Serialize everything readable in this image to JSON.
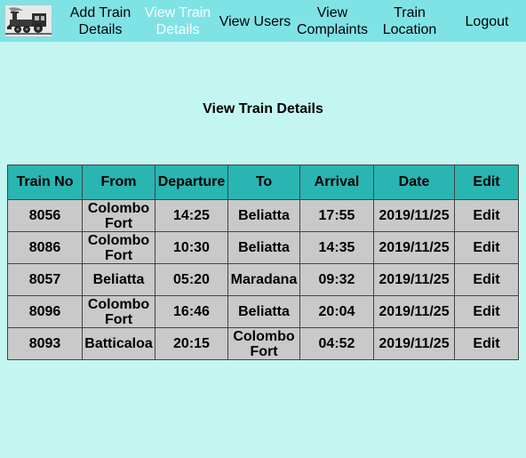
{
  "nav": {
    "logo": "train-logo",
    "items": [
      {
        "line1": "Add Train",
        "line2": "Details",
        "active": false
      },
      {
        "line1": "View Train",
        "line2": "Details",
        "active": true
      },
      {
        "line1": "View Users",
        "line2": "",
        "active": false
      },
      {
        "line1": "View",
        "line2": "Complaints",
        "active": false
      },
      {
        "line1": "Train",
        "line2": "Location",
        "active": false
      },
      {
        "line1": "Logout",
        "line2": "",
        "active": false
      }
    ]
  },
  "page_title": "View Train Details",
  "table": {
    "headers": [
      "Train No",
      "From",
      "Departure",
      "To",
      "Arrival",
      "Date",
      "Edit"
    ],
    "rows": [
      [
        "8056",
        "Colombo Fort",
        "14:25",
        "Beliatta",
        "17:55",
        "2019/11/25",
        "Edit"
      ],
      [
        "8086",
        "Colombo Fort",
        "10:30",
        "Beliatta",
        "14:35",
        "2019/11/25",
        "Edit"
      ],
      [
        "8057",
        "Beliatta",
        "05:20",
        "Maradana",
        "09:32",
        "2019/11/25",
        "Edit"
      ],
      [
        "8096",
        "Colombo Fort",
        "16:46",
        "Beliatta",
        "20:04",
        "2019/11/25",
        "Edit"
      ],
      [
        "8093",
        "Batticaloa",
        "20:15",
        "Colombo Fort",
        "04:52",
        "2019/11/25",
        "Edit"
      ]
    ]
  },
  "colors": {
    "navbar": "#7fe3e6",
    "page_background": "#c4f6f1",
    "table_header": "#29b5b2",
    "table_cell": "#c9c9c9",
    "active_nav_text": "#ffffff"
  }
}
